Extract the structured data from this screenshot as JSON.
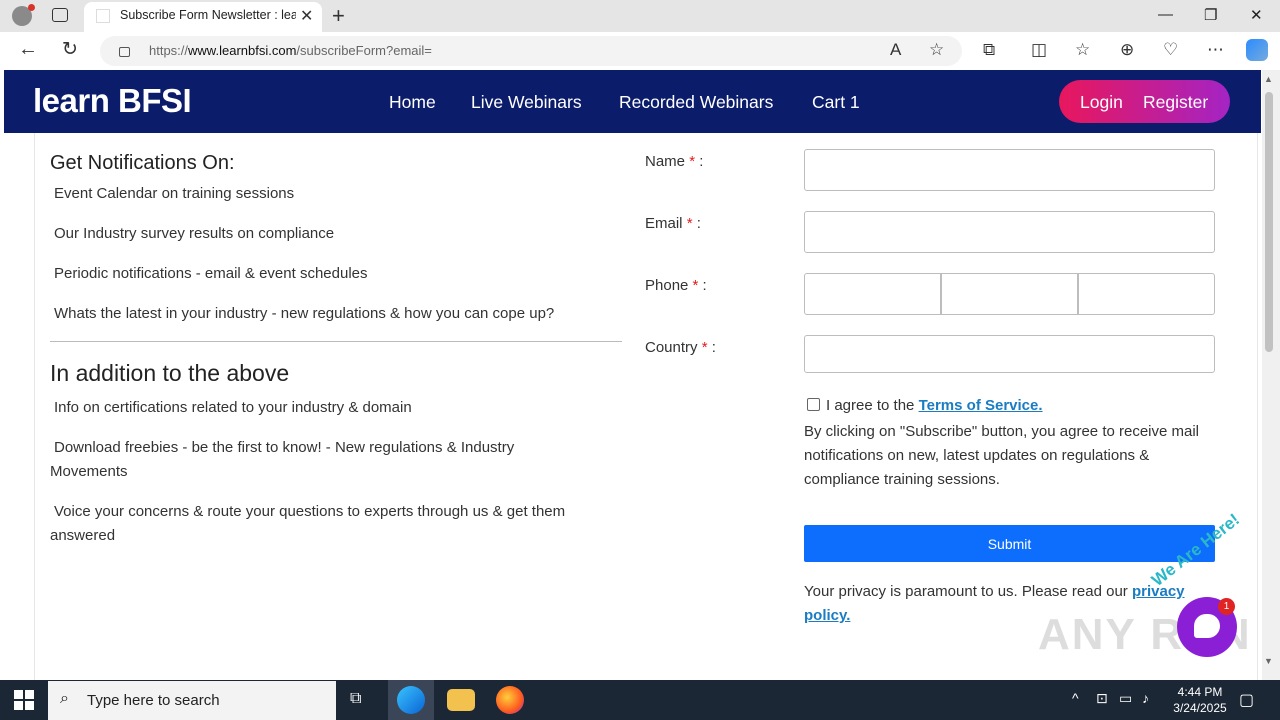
{
  "browser": {
    "tab_title": "Subscribe Form Newsletter : learnbfsi",
    "url_prefix": "https://",
    "url_domain": "www.learnbfsi.com",
    "url_path": "/subscribeForm?email="
  },
  "nav": {
    "logo": "learn BFSI",
    "links": [
      "Home",
      "Live Webinars",
      "Recorded Webinars",
      "Cart 1"
    ],
    "login": "Login",
    "register": "Register"
  },
  "left": {
    "heading1": "Get Notifications On:",
    "items1": [
      "Event Calendar on training sessions",
      "Our Industry survey results on compliance",
      "Periodic notifications - email & event schedules",
      "Whats the latest in your industry - new regulations & how you can cope up?"
    ],
    "heading2": "In addition to the above",
    "items2": [
      "Info on certifications related to your industry & domain",
      "Download freebies - be the first to know! - New regulations & Industry Movements",
      "Voice your concerns & route your questions to experts through us & get them answered"
    ]
  },
  "form": {
    "name_label": "Name",
    "email_label": "Email",
    "phone_label": "Phone",
    "country_label": "Country",
    "required_mark": "*",
    "colon": " :",
    "agree_text": "I agree to the",
    "terms_link": "Terms of Service.",
    "note": "By clicking on \"Subscribe\" button, you agree to receive mail notifications on new, latest updates on regulations & compliance training sessions.",
    "submit": "Submit",
    "privacy_text": "Your privacy is paramount to us. Please read our",
    "privacy_link": "privacy policy."
  },
  "chat": {
    "badge": "1",
    "tagline": "We Are Here!"
  },
  "watermark": "ANY RUN",
  "taskbar": {
    "search_placeholder": "Type here to search",
    "time": "4:44 PM",
    "date": "3/24/2025"
  }
}
